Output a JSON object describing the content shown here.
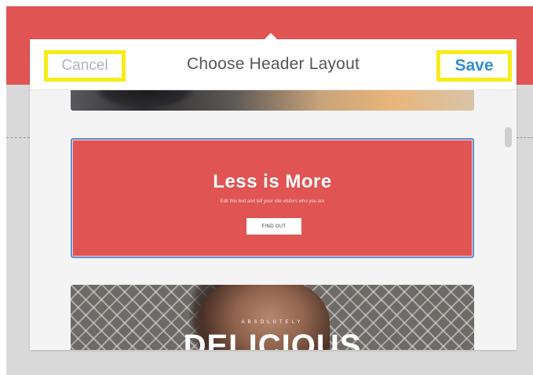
{
  "colors": {
    "accent_red": "#e05454",
    "save_blue": "#2f8fd6",
    "highlight_yellow": "#f5ec19",
    "selected_border": "#5d8fd0"
  },
  "dialog": {
    "title": "Choose Header Layout",
    "cancel_label": "Cancel",
    "save_label": "Save"
  },
  "layouts": [
    {
      "id": "layout-partial-top",
      "visible_text": ""
    },
    {
      "id": "layout-less-is-more",
      "selected": true,
      "headline": "Less is More",
      "subline": "Edit this text and tell your site visitors who you are",
      "button_label": "FIND OUT"
    },
    {
      "id": "layout-delicious",
      "kicker": "ABSOLUTELY",
      "headline": "DELICIOUS"
    }
  ],
  "icons": {
    "scroll_thumb": "scrollbar-thumb",
    "caret": "popover-caret-icon"
  }
}
